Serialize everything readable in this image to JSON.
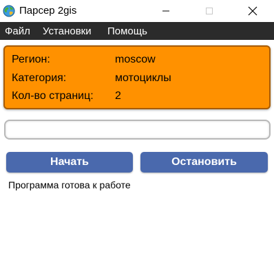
{
  "window": {
    "title": "Парсер 2gis",
    "app_icon": "globe-icon",
    "controls": {
      "minimize": "minimize-icon",
      "maximize": "maximize-icon",
      "close": "close-icon"
    }
  },
  "menu": {
    "items": [
      {
        "label": "Файл"
      },
      {
        "label": "Установки"
      },
      {
        "label": "Помощь"
      }
    ]
  },
  "info": {
    "rows": [
      {
        "label": "Регион:",
        "value": "moscow"
      },
      {
        "label": "Категория:",
        "value": "мотоциклы"
      },
      {
        "label": "Кол-во страниц:",
        "value": "2"
      }
    ]
  },
  "progress": {
    "fraction": 0
  },
  "buttons": {
    "start_label": "Начать",
    "stop_label": "Остановить"
  },
  "status": {
    "text": "Программа готова к работе"
  },
  "colors": {
    "menubar": "#2b2b2b",
    "info_panel": "#ff9100",
    "info_border": "#a85c00",
    "button": "#4a69ad"
  }
}
